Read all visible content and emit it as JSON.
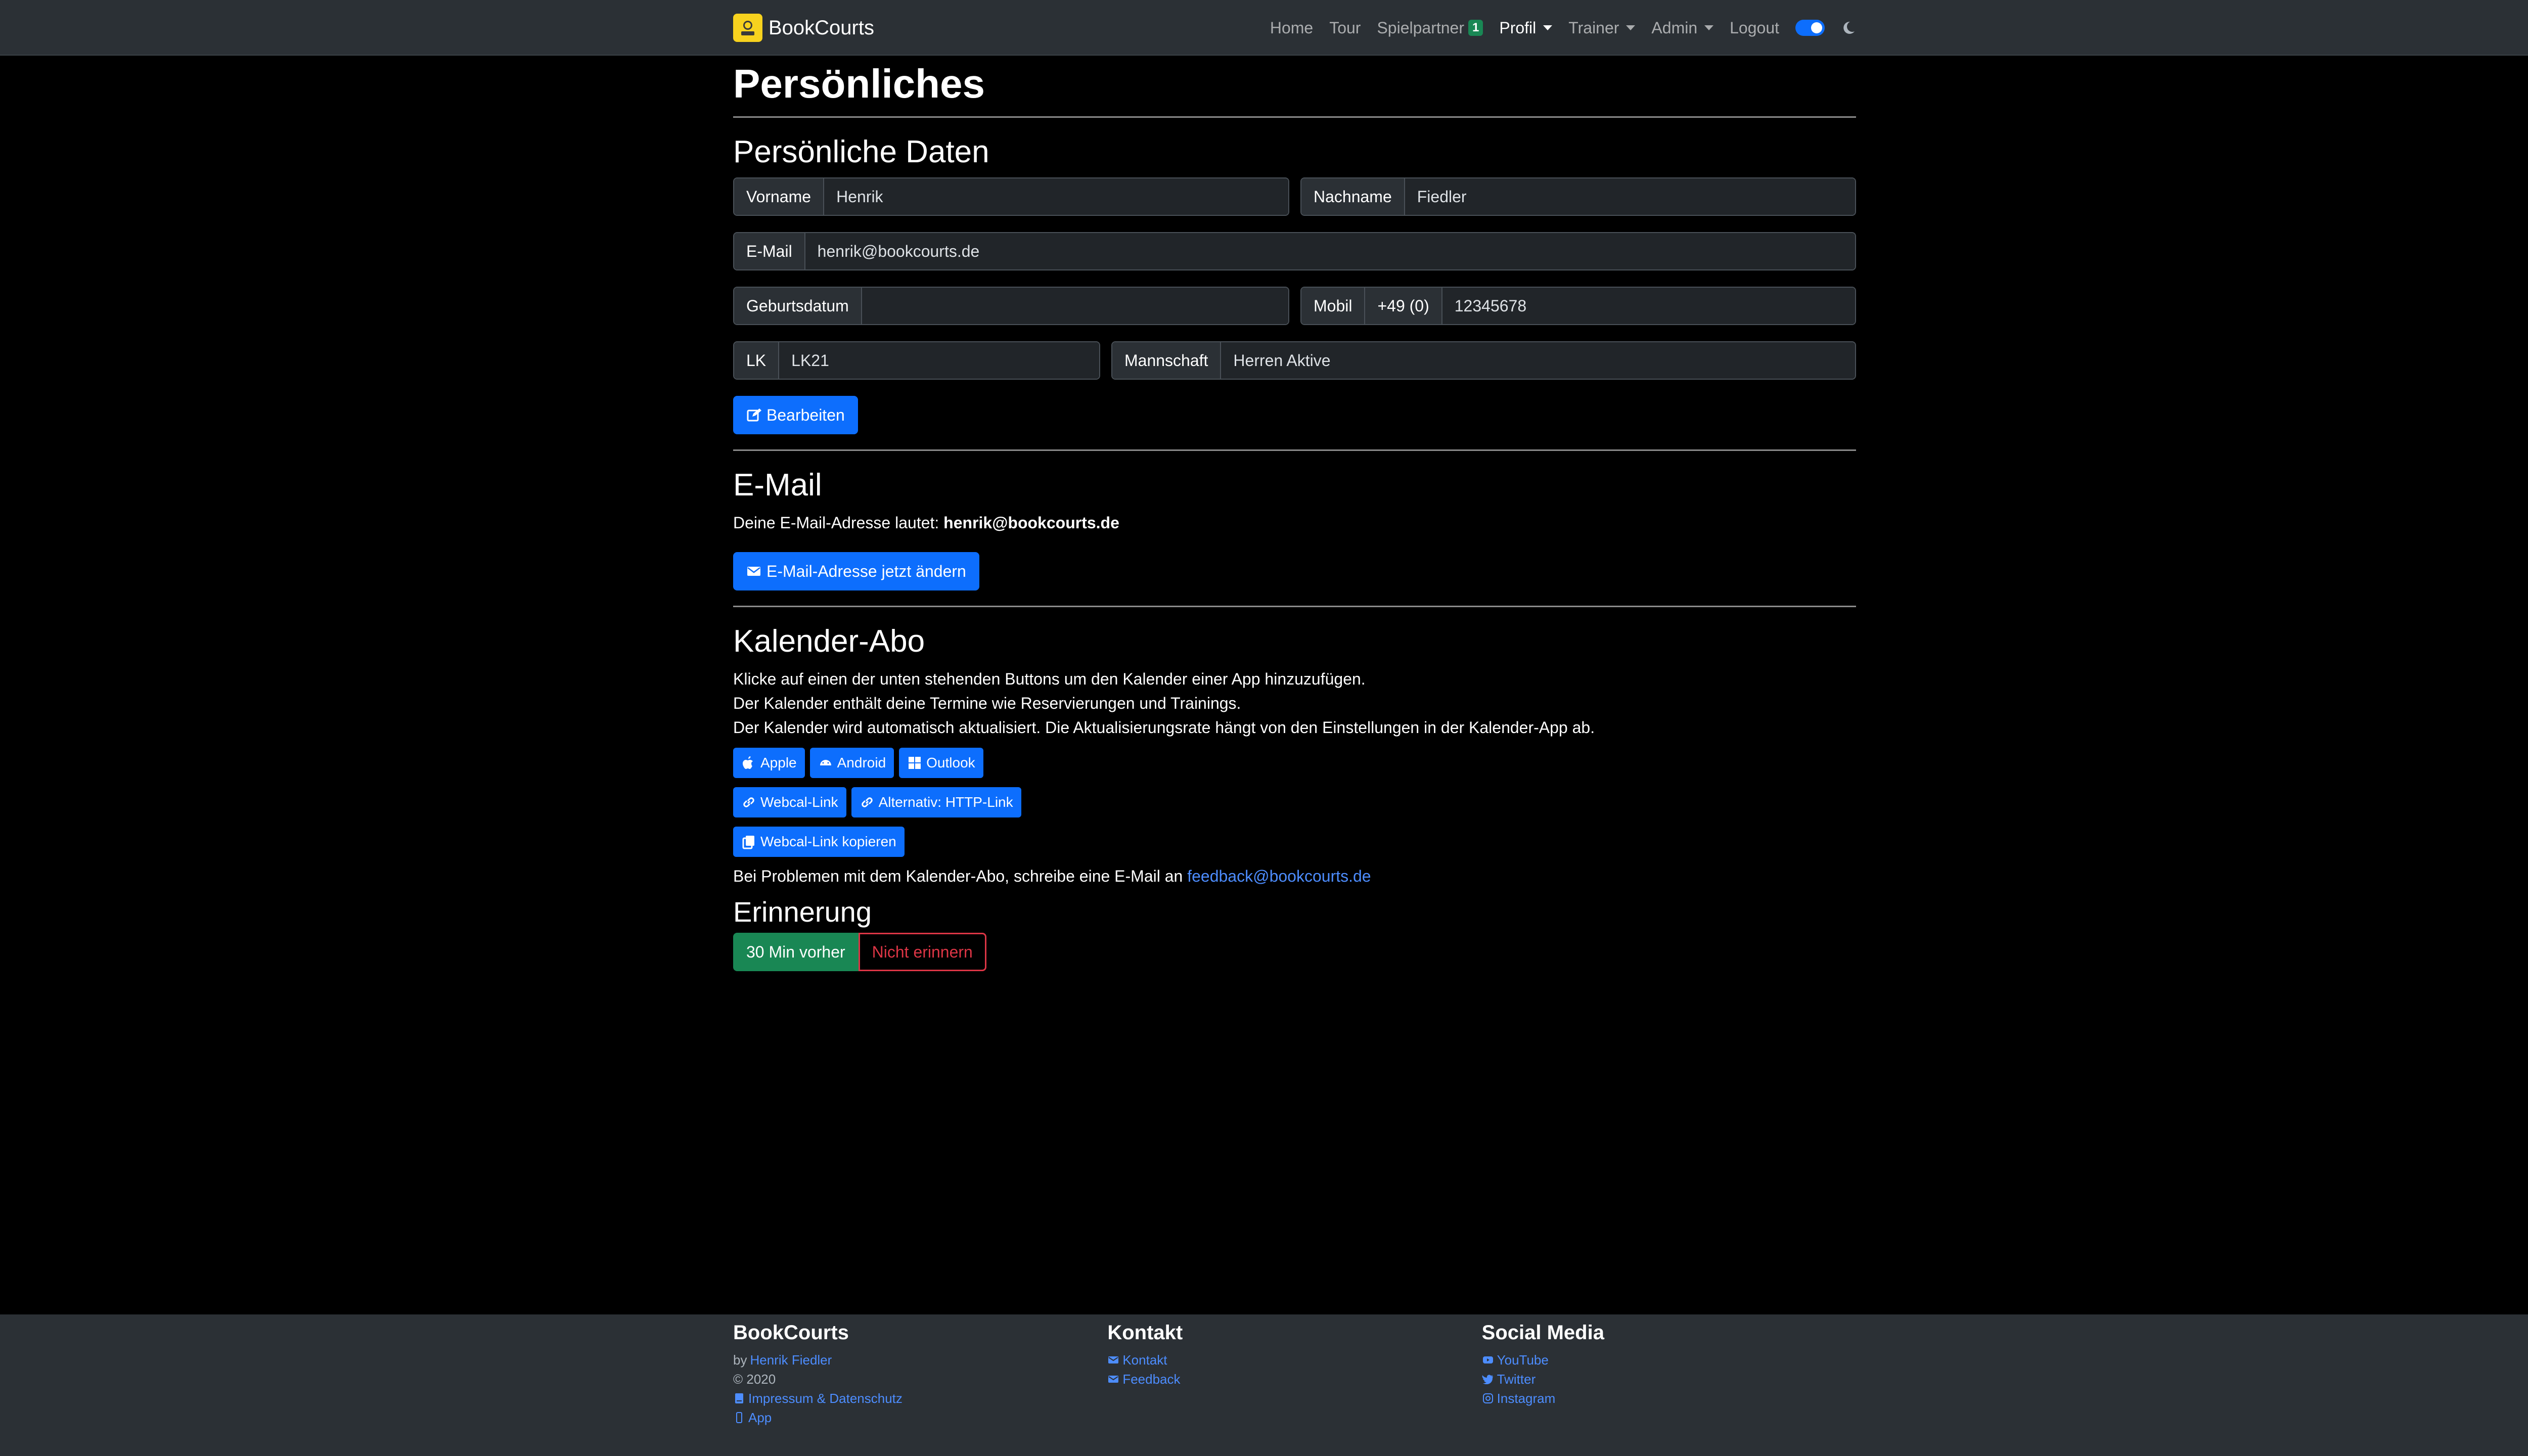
{
  "nav": {
    "brand": "BookCourts",
    "items": [
      {
        "label": "Home"
      },
      {
        "label": "Tour"
      },
      {
        "label": "Spielpartner",
        "badge": "1"
      },
      {
        "label": "Profil"
      },
      {
        "label": "Trainer"
      },
      {
        "label": "Admin"
      },
      {
        "label": "Logout"
      }
    ]
  },
  "page": {
    "title": "Persönliches"
  },
  "personal": {
    "title": "Persönliche Daten",
    "vorname_label": "Vorname",
    "vorname": "Henrik",
    "nachname_label": "Nachname",
    "nachname": "Fiedler",
    "email_label": "E-Mail",
    "email": "henrik@bookcourts.de",
    "geburtsdatum_label": "Geburtsdatum",
    "geburtsdatum": "",
    "mobil_label": "Mobil",
    "mobil_prefix": "+49 (0)",
    "mobil": "12345678",
    "lk_label": "LK",
    "lk": "LK21",
    "mannschaft_label": "Mannschaft",
    "mannschaft": "Herren Aktive",
    "edit_button": "Bearbeiten"
  },
  "email_section": {
    "title": "E-Mail",
    "text": "Deine E-Mail-Adresse lautet: ",
    "address": "henrik@bookcourts.de",
    "change_button": "E-Mail-Adresse jetzt ändern"
  },
  "calendar": {
    "title": "Kalender-Abo",
    "line1": "Klicke auf einen der unten stehenden Buttons um den Kalender einer App hinzuzufügen.",
    "line2": "Der Kalender enthält deine Termine wie Reservierungen und Trainings.",
    "line3": "Der Kalender wird automatisch aktualisiert. Die Aktualisierungsrate hängt von den Einstellungen in der Kalender-App ab.",
    "btn_apple": "Apple",
    "btn_android": "Android",
    "btn_outlook": "Outlook",
    "btn_webcal": "Webcal-Link",
    "btn_http": "Alternativ: HTTP-Link",
    "btn_copy": "Webcal-Link kopieren",
    "problem_text": "Bei Problemen mit dem Kalender-Abo, schreibe eine E-Mail an ",
    "problem_email": "feedback@bookcourts.de"
  },
  "reminder": {
    "title": "Erinnerung",
    "opt_active": "30 Min vorher",
    "opt_none": "Nicht erinnern"
  },
  "footer": {
    "col1": {
      "title": "BookCourts",
      "by": "by ",
      "author": "Henrik Fiedler",
      "copyright": "© 2020",
      "impressum": "Impressum & Datenschutz",
      "app": "App"
    },
    "col2": {
      "title": "Kontakt",
      "kontakt": "Kontakt",
      "feedback": "Feedback"
    },
    "col3": {
      "title": "Social Media",
      "youtube": "YouTube",
      "twitter": "Twitter",
      "instagram": "Instagram"
    }
  },
  "colors": {
    "primary": "#0d6efd",
    "success": "#198754",
    "danger": "#dc3545",
    "navbar": "#2b3035"
  }
}
